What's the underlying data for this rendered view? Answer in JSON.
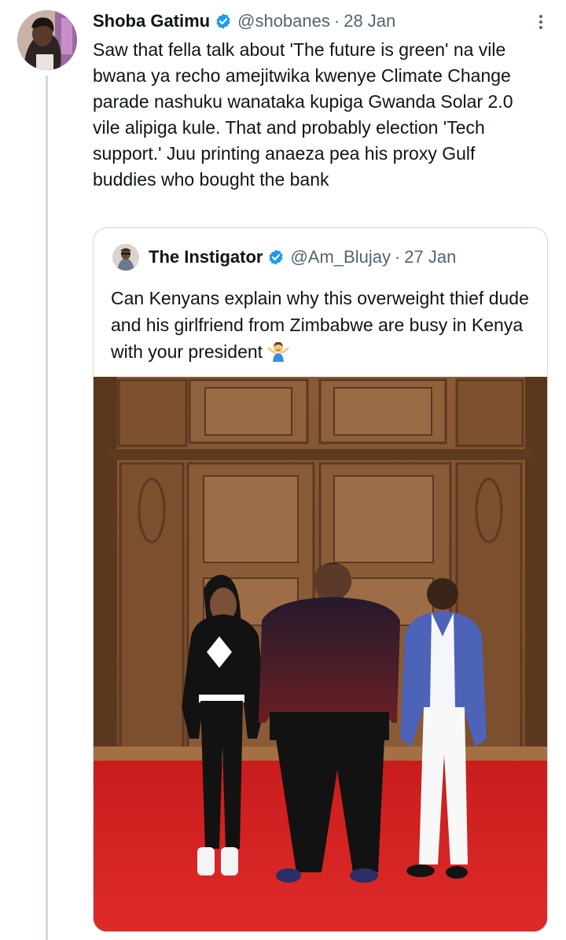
{
  "tweet": {
    "author_name": "Shoba Gatimu",
    "handle": "@shobanes",
    "separator": "·",
    "date": "28 Jan",
    "text": "Saw that fella talk about 'The future is green' na vile bwana ya recho amejitwika kwenye Climate Change parade nashuku wanataka kupiga Gwanda Solar 2.0 vile alipiga kule. That and probably election 'Tech support.' Juu printing anaeza pea his proxy Gulf buddies who bought the bank",
    "more_icon": "more-vertical-icon"
  },
  "quoted_tweet": {
    "author_name": "The Instigator",
    "handle": "@Am_Blujay",
    "separator": "·",
    "date": "27 Jan",
    "text": "Can Kenyans explain why this overweight thief dude and his girlfriend from Zimbabwe are busy in Kenya with your president",
    "emoji": "person-shrugging-emoji",
    "image": "photo-three-people-standing-on-red-carpet-before-wooden-doors"
  },
  "colors": {
    "verified": "#1d9bf0",
    "muted_text": "#536471",
    "border": "#cfd9de",
    "text": "#0f1419"
  }
}
